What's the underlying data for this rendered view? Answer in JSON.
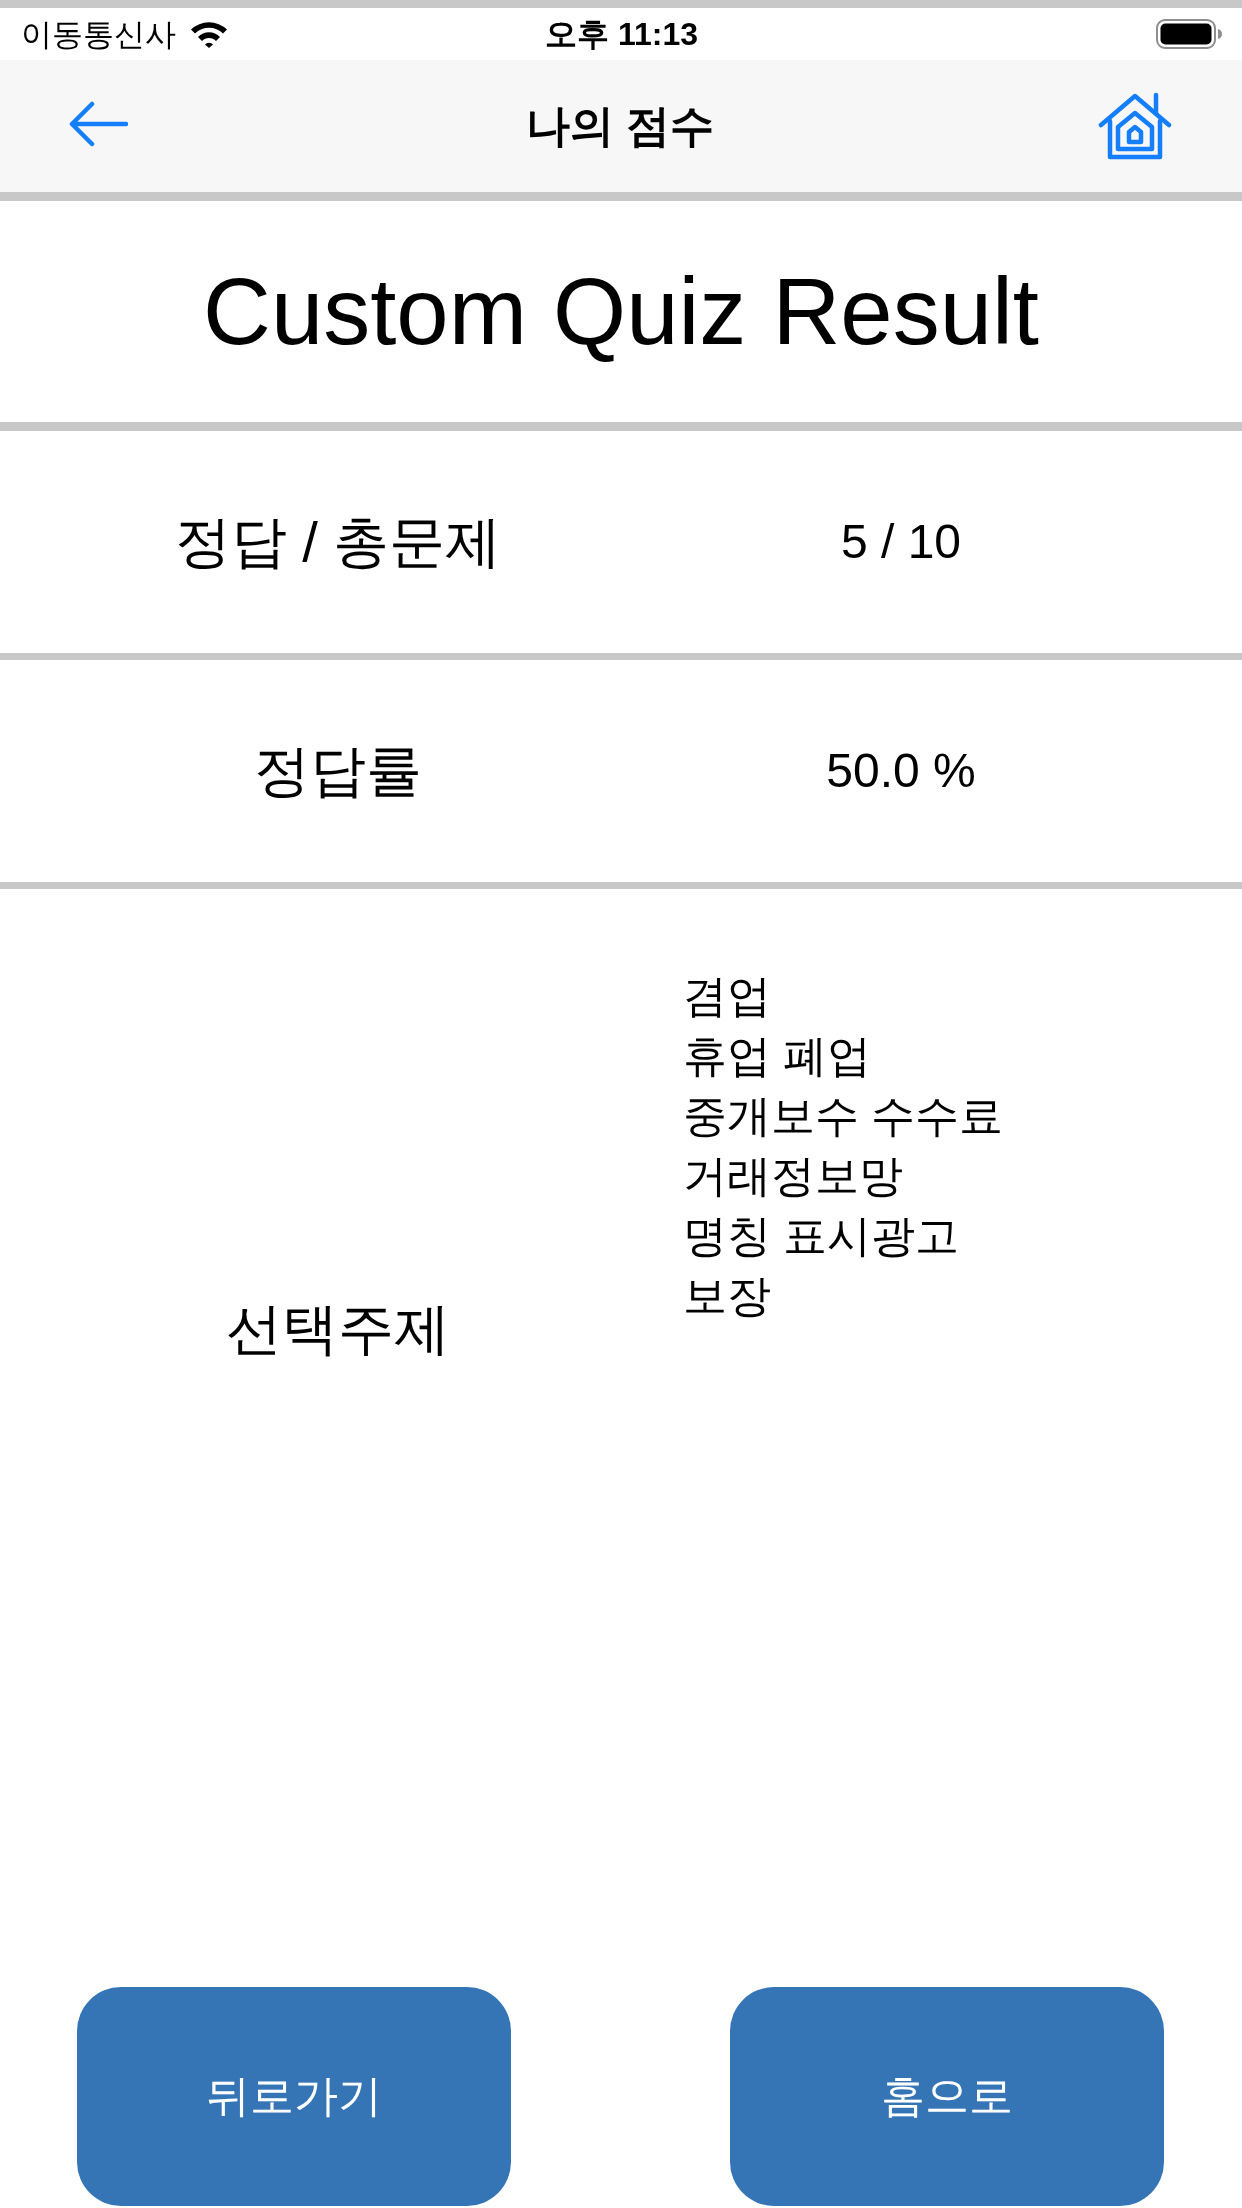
{
  "status_bar": {
    "carrier": "이동통신사",
    "time": "오후 11:13"
  },
  "nav_bar": {
    "title": "나의 점수"
  },
  "heading": "Custom Quiz Result",
  "stats": [
    {
      "label": "정답 / 총문제",
      "value": "5 / 10"
    },
    {
      "label": "정답률",
      "value": "50.0 %"
    }
  ],
  "topics": {
    "label": "선택주제",
    "items": [
      "겸업",
      "휴업 폐업",
      "중개보수 수수료",
      "거래정보망",
      "명칭 표시광고",
      "보장"
    ]
  },
  "buttons": [
    {
      "label": "뒤로가기"
    },
    {
      "label": "홈으로"
    }
  ]
}
